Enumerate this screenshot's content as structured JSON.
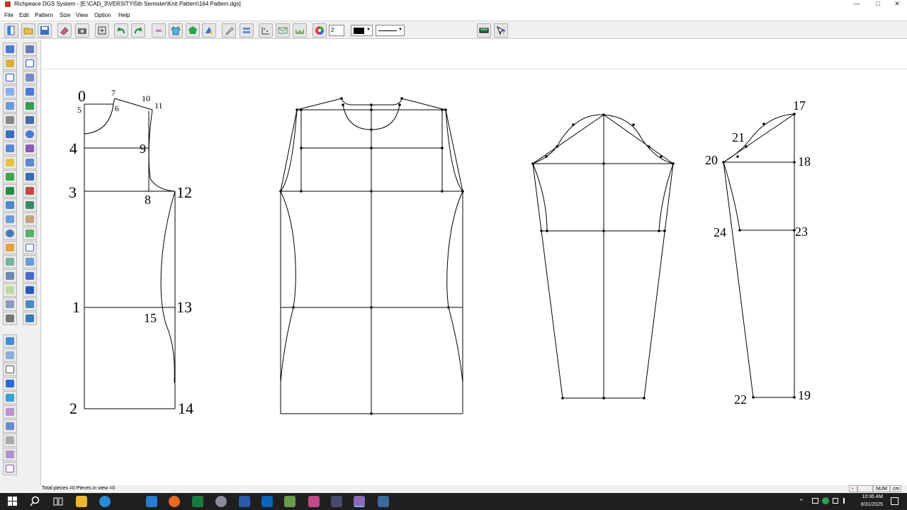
{
  "window": {
    "title": "Richpeace DGS System - [E:\\CAD_3\\VERSITY\\5th Semister\\Knit Pattern\\164 Pattern.dgs]"
  },
  "menu": [
    "File",
    "Edit",
    "Pattern",
    "Size",
    "View",
    "Option",
    "Help"
  ],
  "toolbar": {
    "line_width_value": "2",
    "color_value": "#000000"
  },
  "canvas_labels": {
    "p0": "0",
    "p1": "1",
    "p2": "2",
    "p3": "3",
    "p4": "4",
    "p5": "5",
    "p6": "6",
    "p7": "7",
    "p8": "8",
    "p9": "9",
    "p10": "10",
    "p11": "11",
    "p12": "12",
    "p13": "13",
    "p14": "14",
    "p15": "15",
    "p17": "17",
    "p18": "18",
    "p19": "19",
    "p20": "20",
    "p21": "21",
    "p22": "22",
    "p23": "23",
    "p24": "24"
  },
  "status": {
    "left": "Total pieces =0   Pieces in view =0",
    "indicator": "•",
    "num": "NUM",
    "unit": "cm"
  },
  "taskbar": {
    "time": "10:36 AM",
    "date": "8/31/2025"
  }
}
